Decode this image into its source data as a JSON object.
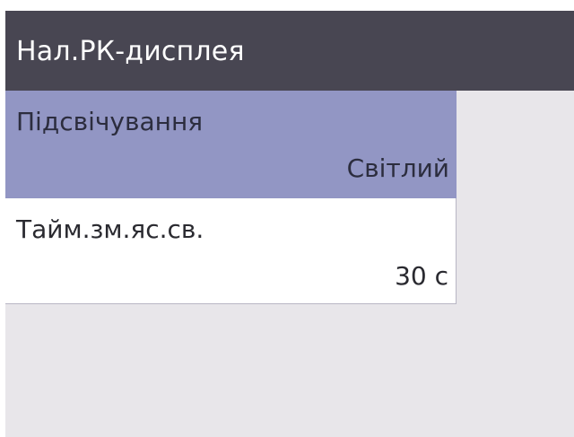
{
  "title_bar": {
    "title": "Нал.РК-дисплея"
  },
  "menu": {
    "items": [
      {
        "label": "Підсвічування",
        "value": "Світлий",
        "selected": true
      },
      {
        "label": "Тайм.зм.яс.св.",
        "value": "30 с",
        "selected": false
      }
    ]
  },
  "colors": {
    "title_bar_bg": "#484652",
    "selected_bg": "#9296c4",
    "panel_bg": "#e8e6ea",
    "item_bg": "#ffffff"
  }
}
